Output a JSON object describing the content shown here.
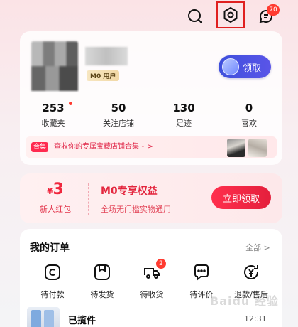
{
  "header": {
    "search_icon": "search-icon",
    "settings_icon": "gear-icon",
    "message_icon": "message-icon",
    "message_badge": "70"
  },
  "profile": {
    "user_tag": "M0 用户",
    "receive_button": "领取",
    "stats": [
      {
        "value": "253",
        "label": "收藏夹",
        "has_dot": true
      },
      {
        "value": "50",
        "label": "关注店铺"
      },
      {
        "value": "130",
        "label": "足迹"
      },
      {
        "value": "0",
        "label": "喜欢"
      }
    ],
    "banner_tag": "合集",
    "banner_text": "查收你的专属宝藏店铺合集~ >"
  },
  "benefit": {
    "currency": "¥",
    "amount": "3",
    "amount_label": "新人红包",
    "title": "M0专享权益",
    "subtitle": "全场无门槛实物通用",
    "claim_button": "立即领取"
  },
  "orders": {
    "title": "我的订单",
    "all_link": "全部 >",
    "items": [
      {
        "label": "待付款",
        "icon": "wallet-icon"
      },
      {
        "label": "待发货",
        "icon": "package-icon"
      },
      {
        "label": "待收货",
        "icon": "truck-icon",
        "badge": "2"
      },
      {
        "label": "待评价",
        "icon": "comment-icon"
      },
      {
        "label": "退款/售后",
        "icon": "refund-icon"
      }
    ],
    "latest_status": "已揽件",
    "latest_time": "12:31"
  },
  "watermark": "Baidu 经验",
  "colors": {
    "accent": "#ff2b50",
    "button_blue": "#3e4fdc",
    "badge": "#ff3b30"
  }
}
